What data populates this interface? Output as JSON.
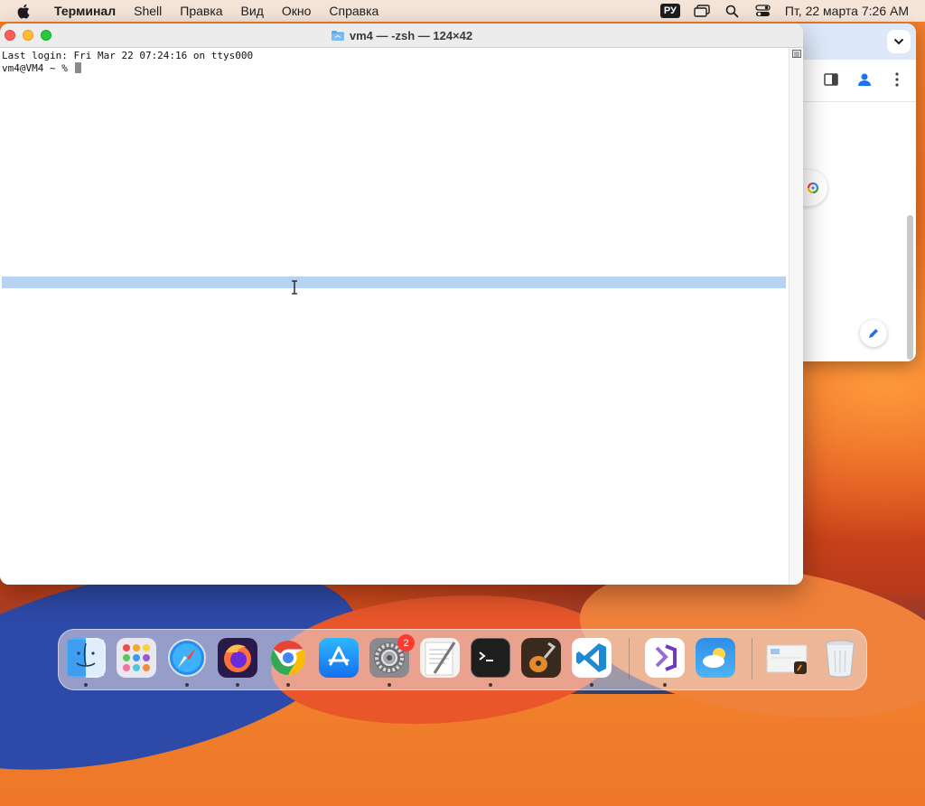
{
  "menubar": {
    "app_name": "Терминал",
    "items": [
      "Shell",
      "Правка",
      "Вид",
      "Окно",
      "Справка"
    ],
    "input_source": "РУ",
    "clock": "Пт, 22 марта  7:26 AM"
  },
  "terminal": {
    "title": "vm4 — -zsh — 124×42",
    "lines": [
      "Last login: Fri Mar 22 07:24:16 on ttys000",
      "vm4@VM4 ~ % "
    ]
  },
  "chrome": {
    "icons": [
      "chevron-down-icon",
      "sidebar-icon",
      "profile-icon",
      "more-icon",
      "google-lens-icon",
      "pencil-icon"
    ]
  },
  "dock": {
    "items": [
      {
        "name": "Finder",
        "icon": "finder-icon",
        "running": true
      },
      {
        "name": "Launchpad",
        "icon": "launchpad-icon",
        "running": false
      },
      {
        "name": "Safari",
        "icon": "safari-icon",
        "running": true
      },
      {
        "name": "Firefox",
        "icon": "firefox-icon",
        "running": true
      },
      {
        "name": "Google Chrome",
        "icon": "chrome-icon",
        "running": true
      },
      {
        "name": "App Store",
        "icon": "app-store-icon",
        "running": false
      },
      {
        "name": "System Settings",
        "icon": "settings-icon",
        "running": true,
        "badge": "2"
      },
      {
        "name": "TextEdit",
        "icon": "textedit-icon",
        "running": false
      },
      {
        "name": "Terminal",
        "icon": "terminal-icon",
        "running": true
      },
      {
        "name": "GarageBand",
        "icon": "garageband-icon",
        "running": false
      },
      {
        "name": "Visual Studio Code",
        "icon": "vscode-icon",
        "running": true
      },
      {
        "name": "Visual Studio",
        "icon": "visual-studio-icon",
        "running": true
      },
      {
        "name": "Weather",
        "icon": "weather-icon",
        "running": false
      },
      {
        "name": "Downloads",
        "icon": "downloads-stack-icon",
        "running": false
      },
      {
        "name": "Trash",
        "icon": "trash-icon",
        "running": false
      }
    ]
  },
  "colors": {
    "selection": "#b6d3f2",
    "close": "#ff5f57",
    "minimize": "#febc2e",
    "zoom": "#28c840",
    "badge": "#ff3b30"
  }
}
